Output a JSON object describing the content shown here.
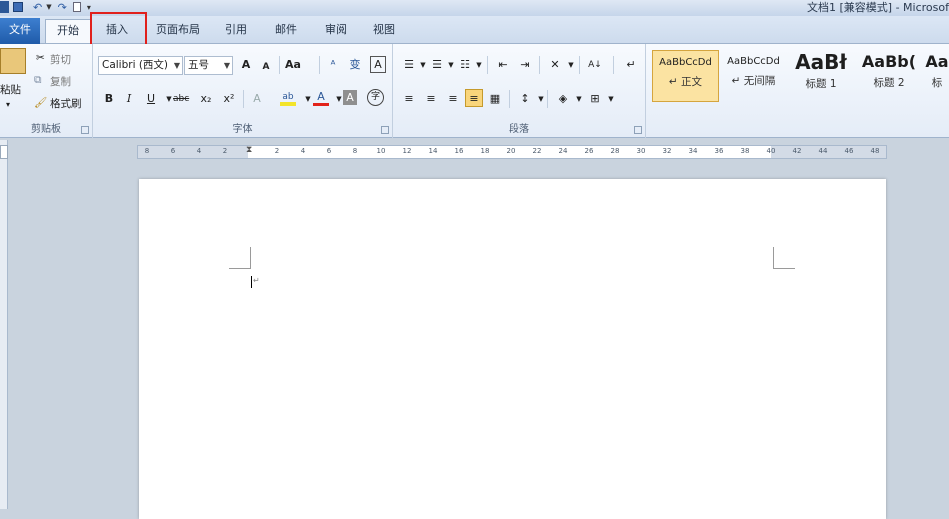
{
  "window": {
    "title": "文档1 [兼容模式] - Microsof"
  },
  "tabs": [
    {
      "id": "file",
      "label": "文件"
    },
    {
      "id": "home",
      "label": "开始"
    },
    {
      "id": "insert",
      "label": "插入"
    },
    {
      "id": "page_layout",
      "label": "页面布局"
    },
    {
      "id": "references",
      "label": "引用"
    },
    {
      "id": "mailings",
      "label": "邮件"
    },
    {
      "id": "review",
      "label": "审阅"
    },
    {
      "id": "view",
      "label": "视图"
    }
  ],
  "clipboard": {
    "paste": "粘贴",
    "cut": "剪切",
    "copy": "复制",
    "format_painter": "格式刷",
    "group_label": "剪贴板"
  },
  "font": {
    "name": "Calibri (西文)",
    "size": "五号",
    "grow": "A",
    "shrink": "A",
    "change_case": "Aa",
    "clear": "A",
    "bold": "B",
    "italic": "I",
    "underline": "U",
    "strike": "abc",
    "subscript": "x₂",
    "superscript": "x²",
    "text_effect": "A",
    "highlight": "ab",
    "font_color": "A",
    "char_shade": "A",
    "enclose": "字",
    "group_label": "字体"
  },
  "paragraph": {
    "group_label": "段落",
    "sort": "A↓"
  },
  "styles": [
    {
      "sample": "AaBbCcDd",
      "name": "↵ 正文",
      "selected": true
    },
    {
      "sample": "AaBbCcDd",
      "name": "↵ 无间隔",
      "selected": false
    },
    {
      "sample": "AaBł",
      "name": "标题 1",
      "selected": false
    },
    {
      "sample": "AaBb(",
      "name": "标题 2",
      "selected": false
    },
    {
      "sample": "Aa",
      "name": "标",
      "selected": false
    }
  ],
  "ruler": {
    "ticks": [
      "8",
      "6",
      "4",
      "2",
      "",
      "2",
      "4",
      "6",
      "8",
      "10",
      "12",
      "14",
      "16",
      "18",
      "20",
      "22",
      "24",
      "26",
      "28",
      "30",
      "32",
      "34",
      "36",
      "38",
      "40",
      "42",
      "44",
      "46",
      "48"
    ]
  },
  "colors": {
    "accent": "#2b5797",
    "highlight_border": "#e0201c",
    "file_tab": "#2a68b8"
  }
}
